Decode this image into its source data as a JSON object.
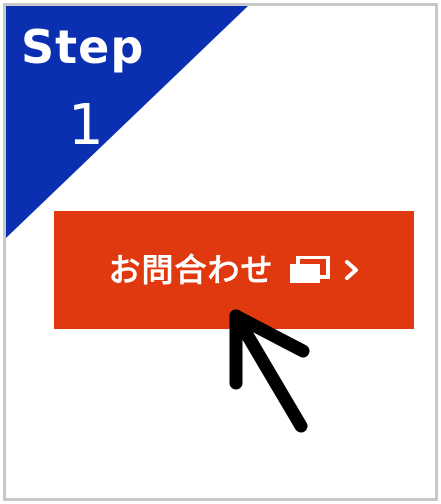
{
  "step": {
    "label": "Step",
    "number": "1"
  },
  "contact_button": {
    "label": "お問合わせ",
    "icons": [
      "window-icon",
      "chevron-right-icon"
    ]
  },
  "cursor": {
    "icon": "arrow-cursor-icon"
  },
  "colors": {
    "step_badge": "#0a2fb0",
    "button": "#e0390f",
    "text": "#ffffff",
    "border": "#c8c8c8"
  }
}
